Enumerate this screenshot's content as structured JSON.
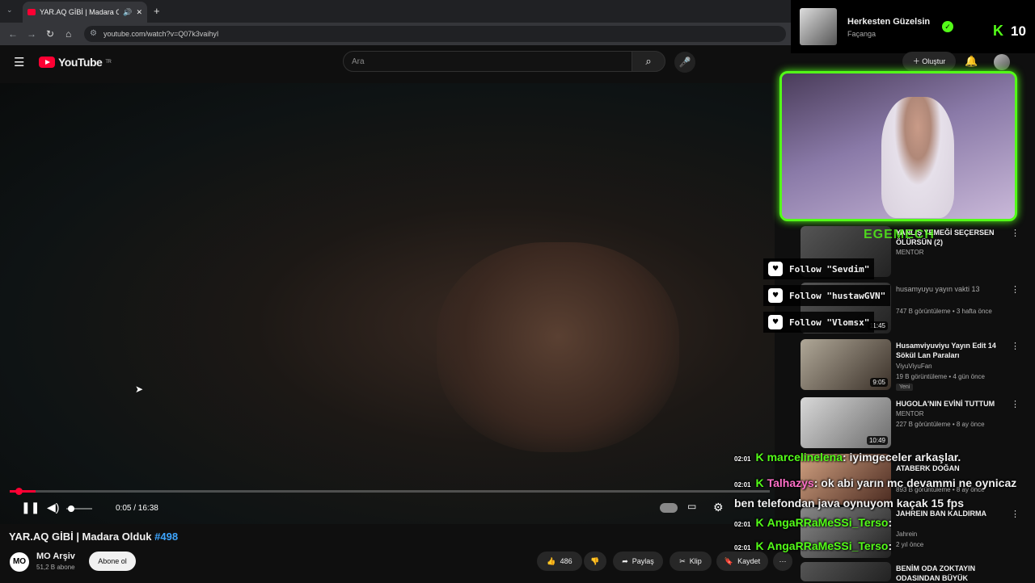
{
  "browser": {
    "tab_title": "YAR.AQ GİBİ | Madara Olduk",
    "url": "youtube.com/watch?v=Q07k3vaihyI"
  },
  "youtube": {
    "logo": "YouTube",
    "region": "TR",
    "search_placeholder": "Ara",
    "create_label": "Oluştur"
  },
  "player": {
    "time": "0:05 / 16:38",
    "progress_fraction": 0.005
  },
  "video": {
    "title": "YAR.AQ GİBİ | Madara Olduk",
    "hashtag": "#498",
    "channel": "MO Arşiv",
    "channel_avatar": "MO",
    "subscribers": "51,2 B abone",
    "subscribe_label": "Abone ol",
    "likes": "486",
    "share_label": "Paylaş",
    "clip_label": "Klip",
    "save_label": "Kaydet"
  },
  "overlay": {
    "song_title": "Herkesten Güzelsin",
    "song_artist": "Façanga",
    "kick_count": "10",
    "cam_label": "EGEMECH"
  },
  "follows": [
    "Follow \"Sevdim\"",
    "Follow \"hustawGVN\"",
    "Follow \"Vlomsx\""
  ],
  "recommendations": [
    {
      "title": "YANLIŞ YEMEĞİ SEÇERSEN ÖLÜRSÜN (2)",
      "channel": "MENTOR",
      "meta": "",
      "duration": ""
    },
    {
      "title": "husamyuyu yayın vakti 13",
      "channel": "",
      "meta": "747 B görüntüleme • 3 hafta önce",
      "duration": "11:45"
    },
    {
      "title": "Husamviyuviyu Yayın Edit 14 Sökül Lan Paraları",
      "channel": "ViyuViyuFan",
      "meta": "19 B görüntüleme • 4 gün önce",
      "duration": "9:05",
      "badge": "Yeni"
    },
    {
      "title": "HUGOLA'NIN EVİNİ TUTTUM",
      "channel": "MENTOR",
      "meta": "227 B görüntüleme • 8 ay önce",
      "duration": "10:49"
    },
    {
      "title": "ATABERK DOĞAN",
      "channel": "",
      "meta": "893 B görüntüleme • 8 ay önce",
      "duration": ""
    },
    {
      "title": "JAHREIN BAN KALDIRMA",
      "channel": "Jahrein",
      "meta": "2 yıl önce",
      "duration": ""
    },
    {
      "title": "BENİM ODA ZOKTAYIN ODASINDAN BÜYÜK",
      "channel": "",
      "meta": "",
      "duration": ""
    }
  ],
  "chat": [
    {
      "time": "02:01",
      "user": "marcelinelena",
      "color": "#53fc18",
      "msg": "iyimgeceler arkaşlar."
    },
    {
      "time": "02:01",
      "user": "Talhazys",
      "color": "#ff6fc8",
      "msg": "ok abi yarın mc devammi ne oynicaz ben telefondan java oynuyom kaçak 15 fps"
    },
    {
      "time": "02:01",
      "user": "AngaRRaMeSSi_Terso",
      "color": "#53fc18",
      "msg": ""
    },
    {
      "time": "02:01",
      "user": "AngaRRaMeSSi_Terso",
      "color": "#53fc18",
      "msg": ""
    }
  ]
}
